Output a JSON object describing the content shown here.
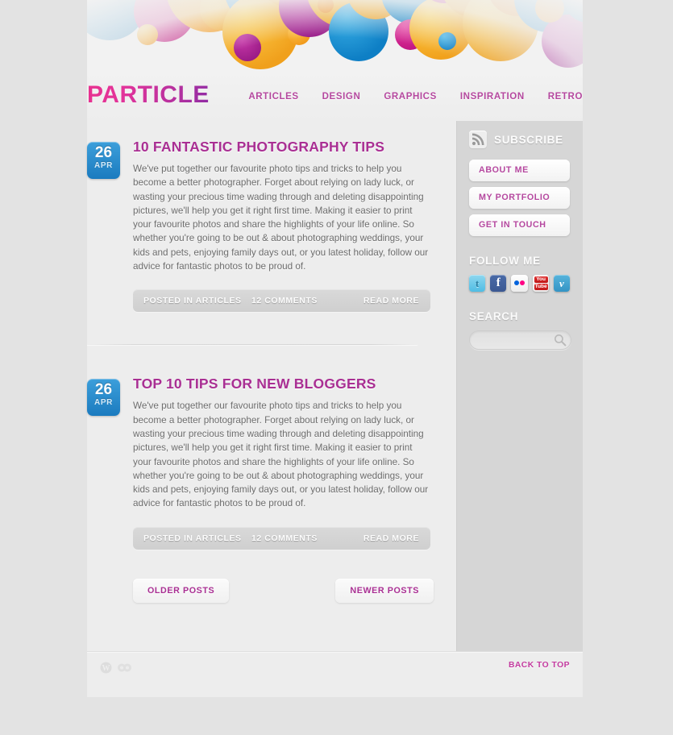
{
  "site": {
    "logo": "PARTICLE",
    "brand_color": "#b5489f",
    "accent_color": "#a92f93",
    "date_badge_color": "#2f8fcf"
  },
  "nav": {
    "items": [
      {
        "label": "ARTICLES"
      },
      {
        "label": "DESIGN"
      },
      {
        "label": "GRAPHICS"
      },
      {
        "label": "INSPIRATION"
      },
      {
        "label": "RETRO"
      }
    ]
  },
  "posts": [
    {
      "day": "26",
      "month": "APR",
      "title": "10 FANTASTIC PHOTOGRAPHY TIPS",
      "excerpt": "We've put together our favourite photo tips and tricks to help you become a better photographer. Forget about relying on lady luck, or wasting your precious time wading through and deleting disappointing pictures, we'll help you get it right first time. Making it easier to print your favourite photos and share the highlights of your life online. So whether you're going to be out & about photographing weddings, your kids and pets, enjoying family days out, or you latest holiday, follow our advice for fantastic photos to be proud of.",
      "category_label": "POSTED IN ARTICLES",
      "comments_label": "12 COMMENTS",
      "readmore_label": "READ MORE"
    },
    {
      "day": "26",
      "month": "APR",
      "title": "TOP 10 TIPS FOR NEW BLOGGERS",
      "excerpt": "We've put together our favourite photo tips and tricks to help you become a better photographer. Forget about relying on lady luck, or wasting your precious time wading through and deleting disappointing pictures, we'll help you get it right first time. Making it easier to print your favourite photos and share the highlights of your life online. So whether you're going to be out & about photographing weddings, your kids and pets, enjoying family days out, or you latest holiday, follow our advice for fantastic photos to be proud of.",
      "category_label": "POSTED IN ARTICLES",
      "comments_label": "12 COMMENTS",
      "readmore_label": "READ MORE"
    }
  ],
  "pagination": {
    "older_label": "OLDER POSTS",
    "newer_label": "NEWER POSTS"
  },
  "sidebar": {
    "subscribe": {
      "label": "SUBSCRIBE",
      "icon": "rss-icon"
    },
    "links": [
      {
        "label": "ABOUT ME"
      },
      {
        "label": "MY PORTFOLIO"
      },
      {
        "label": "GET IN TOUCH"
      }
    ],
    "follow": {
      "title": "FOLLOW ME",
      "icons": [
        {
          "name": "twitter-icon",
          "glyph": "t",
          "color": "#4fbde4"
        },
        {
          "name": "facebook-icon",
          "glyph": "f",
          "color": "#3b5892"
        },
        {
          "name": "flickr-icon",
          "glyph": "",
          "color": "#ffffff"
        },
        {
          "name": "youtube-icon",
          "glyph": "",
          "color": "#cc1f1f"
        },
        {
          "name": "vimeo-icon",
          "glyph": "v",
          "color": "#3494c4"
        }
      ]
    },
    "search": {
      "title": "SEARCH",
      "value": "",
      "placeholder": "",
      "icon": "search-icon"
    }
  },
  "footer": {
    "back_to_top": "BACK TO TOP",
    "icons": [
      {
        "name": "wordpress-icon"
      },
      {
        "name": "css-validator-icon"
      }
    ]
  }
}
